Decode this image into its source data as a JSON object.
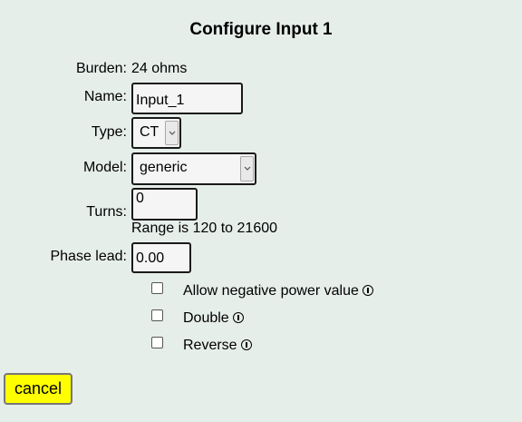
{
  "title": "Configure Input 1",
  "burden": {
    "label": "Burden:",
    "value": "24 ohms"
  },
  "name": {
    "label": "Name:",
    "value": "Input_1"
  },
  "type": {
    "label": "Type:",
    "selected": "CT"
  },
  "model": {
    "label": "Model:",
    "selected": "generic"
  },
  "turns": {
    "label": "Turns:",
    "value": "0",
    "hint": "Range is 120 to 21600"
  },
  "phase_lead": {
    "label": "Phase lead:",
    "value": "0.00"
  },
  "options": [
    {
      "label": "Allow negative power value",
      "checked": false,
      "icon": "info-icon"
    },
    {
      "label": "Double",
      "checked": false,
      "icon": "info-icon"
    },
    {
      "label": "Reverse",
      "checked": false,
      "icon": "info-icon"
    }
  ],
  "cancel_label": "cancel"
}
